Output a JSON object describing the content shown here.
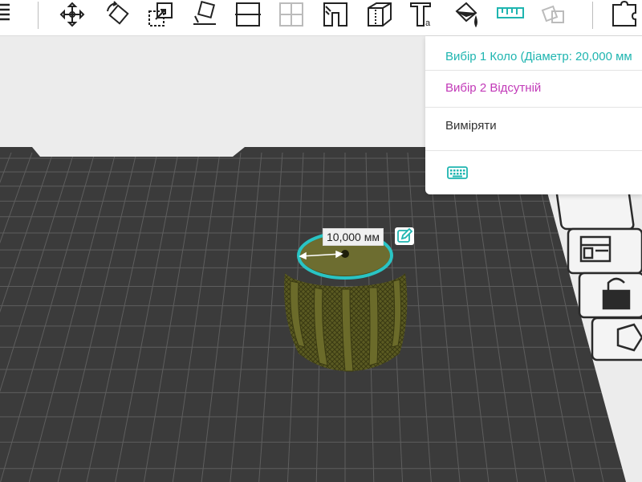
{
  "toolbar": {
    "icons": [
      "menu-icon",
      "move-icon",
      "rotate-icon",
      "scale-icon",
      "place-on-face-icon",
      "cut-icon",
      "mirror-icon",
      "support-icon",
      "seam-icon",
      "variable-layer-icon",
      "text-icon",
      "color-paint-icon",
      "measure-icon",
      "assembly-icon",
      "puzzle-icon"
    ]
  },
  "measure_panel": {
    "selection_1": "Вибір 1 Коло (Діаметр: 20,000 мм",
    "selection_2": "Вибір 2 Відсутній",
    "measure_label": "Виміряти",
    "keyboard_icon": "keyboard-icon"
  },
  "dimension": {
    "value_text": "10,000 мм"
  },
  "colors": {
    "accent_teal": "#1fb5b0",
    "accent_magenta": "#c23ab8",
    "model": "#5a5a22",
    "plate": "#3b3b3b",
    "selection_ring": "#29c4c4"
  }
}
